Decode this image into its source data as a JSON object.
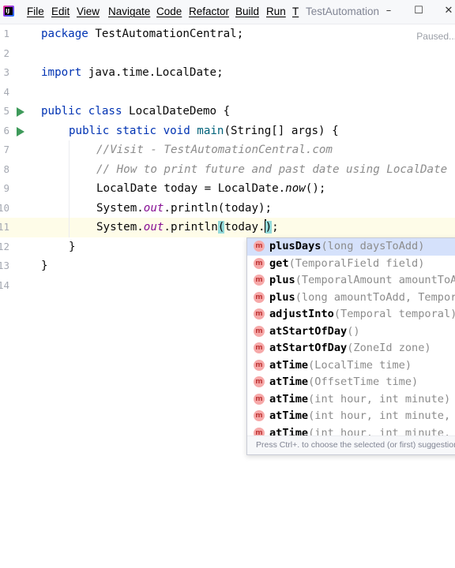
{
  "titlebar": {
    "logo_text": "IJ",
    "menu": [
      "File",
      "Edit",
      "View",
      "Navigate",
      "Code",
      "Refactor",
      "Build",
      "Run",
      "T"
    ],
    "window_title": "TestAutomation",
    "minimize_glyph": "–",
    "maximize_glyph": "☐",
    "close_glyph": "✕"
  },
  "editor": {
    "status": "Paused...",
    "line_numbers": [
      "1",
      "2",
      "3",
      "4",
      "5",
      "6",
      "7",
      "8",
      "9",
      "10",
      "11",
      "12",
      "13",
      "14"
    ],
    "code": {
      "l1_kw": "package",
      "l1_rest": " TestAutomationCentral;",
      "l3_kw": "import",
      "l3_rest": " java.time.LocalDate;",
      "l5_kw": "public class",
      "l5_rest": " LocalDateDemo {",
      "l6_kw": "public static",
      "l6_mid": " void ",
      "l6_name": "main",
      "l6_rest": "(String[] args) {",
      "l7_comment": "//Visit - TestAutomationCentral.com",
      "l8_comment": "// How to print future and past date using LocalDate",
      "l9_a": "LocalDate today = LocalDate.",
      "l9_now": "now",
      "l9_b": "();",
      "l10_a": "System.",
      "l10_out": "out",
      "l10_b": ".println(today);",
      "l11_a": "System.",
      "l11_out": "out",
      "l11_b": ".println",
      "l11_open": "(",
      "l11_c": "today.",
      "l11_close": ")",
      "l11_d": ";",
      "l12": "}",
      "l13": "}"
    },
    "current_line": "11"
  },
  "completion": {
    "icon_letter": "m",
    "items": [
      {
        "name": "plusDays",
        "params": "(long daysToAdd)"
      },
      {
        "name": "get",
        "params": "(TemporalField field)"
      },
      {
        "name": "plus",
        "params": "(TemporalAmount amountToAdd)"
      },
      {
        "name": "plus",
        "params": "(long amountToAdd, TemporalUnit unit)"
      },
      {
        "name": "adjustInto",
        "params": "(Temporal temporal)"
      },
      {
        "name": "atStartOfDay",
        "params": "()"
      },
      {
        "name": "atStartOfDay",
        "params": "(ZoneId zone)"
      },
      {
        "name": "atTime",
        "params": "(LocalTime time)"
      },
      {
        "name": "atTime",
        "params": "(OffsetTime time)"
      },
      {
        "name": "atTime",
        "params": "(int hour, int minute)"
      },
      {
        "name": "atTime",
        "params": "(int hour, int minute, int second)"
      },
      {
        "name": "atTime",
        "params": "(int hour, int minute, int second, int nanoOfSecond)"
      }
    ],
    "selected_index": 0,
    "hint": "Press Ctrl+. to choose the selected (or first) suggestion"
  },
  "colors": {
    "keyword": "#0033b3",
    "comment": "#8c8c8c",
    "static_field": "#871094",
    "method_decl": "#00627a",
    "run_gutter": "#3e9a5a",
    "selection": "#d5e1fb",
    "current_line": "#fefce8",
    "brace_match": "#93d9d9"
  }
}
